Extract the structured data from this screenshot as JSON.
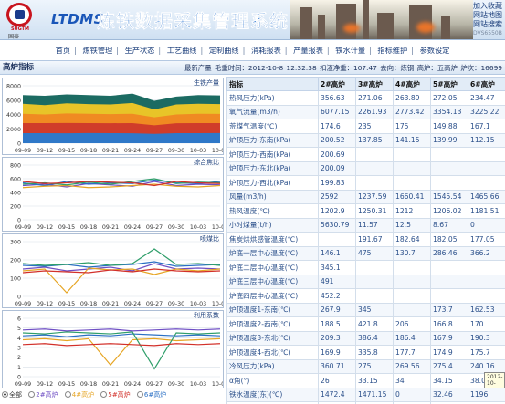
{
  "banner": {
    "logo_caption": "SUGTM",
    "logo_text": "国泰",
    "brand": "LTDMS",
    "title": "炼铁数据采集管理系统",
    "links": [
      "加入收藏",
      "网站地图",
      "网站搜索"
    ],
    "version": "DVS6550B"
  },
  "nav": [
    "首页",
    "炼铁管理",
    "生产状态",
    "工艺曲线",
    "定制曲线",
    "消耗报表",
    "产量报表",
    "铁水计量",
    "指标维护",
    "参数设定"
  ],
  "status": {
    "section_title": "高炉指标",
    "update_label": "最新产量 毛重时间：2012-10-8 12:32:38",
    "tapping_label": "扣渣净重：107.47",
    "grade_label": "去向：炼钢",
    "furnace_label": "高炉：五高炉",
    "count_label": "炉次：16699"
  },
  "charts": [
    {
      "title": "生铁产量",
      "yticks": [
        "8000",
        "6000",
        "4000",
        "2000",
        "0"
      ]
    },
    {
      "title": "综合焦比",
      "yticks": [
        "800",
        "600",
        "400",
        "200",
        "0"
      ]
    },
    {
      "title": "喷煤比",
      "yticks": [
        "300",
        "200",
        "100",
        "0"
      ]
    },
    {
      "title": "利用系数",
      "yticks": [
        "6",
        "5",
        "4",
        "3",
        "2",
        "1",
        "0"
      ]
    }
  ],
  "chart_data": [
    {
      "type": "area",
      "title": "生铁产量",
      "x": [
        "09-09",
        "09-12",
        "09-15",
        "09-18",
        "09-21",
        "09-24",
        "09-27",
        "09-30",
        "10-03",
        "10-06"
      ],
      "ylim": [
        0,
        8000
      ],
      "series": [
        {
          "values": [
            1400,
            1400,
            1380,
            1420,
            1400,
            1380,
            1300,
            1400,
            1400,
            1420
          ]
        },
        {
          "values": [
            2800,
            2790,
            2810,
            2800,
            2780,
            2800,
            2500,
            2780,
            2790,
            2800
          ]
        },
        {
          "values": [
            4100,
            4000,
            4150,
            4100,
            4050,
            4100,
            3600,
            4000,
            4100,
            4080
          ]
        },
        {
          "values": [
            5500,
            5300,
            5550,
            5450,
            5400,
            5600,
            4700,
            5400,
            5500,
            5450
          ]
        },
        {
          "values": [
            6700,
            6600,
            6800,
            6700,
            6600,
            6900,
            5900,
            6500,
            6700,
            6650
          ]
        }
      ]
    },
    {
      "type": "line",
      "title": "综合焦比",
      "x": [
        "09-09",
        "09-12",
        "09-15",
        "09-18",
        "09-21",
        "09-24",
        "09-27",
        "09-30",
        "10-03",
        "10-06"
      ],
      "ylim": [
        0,
        800
      ],
      "series": [
        {
          "values": [
            500,
            520,
            480,
            530,
            510,
            490,
            560,
            500,
            520,
            510
          ]
        },
        {
          "values": [
            540,
            500,
            560,
            520,
            540,
            530,
            580,
            540,
            530,
            560
          ]
        },
        {
          "values": [
            470,
            490,
            500,
            470,
            480,
            500,
            520,
            490,
            480,
            500
          ]
        },
        {
          "values": [
            520,
            540,
            510,
            550,
            520,
            560,
            600,
            530,
            550,
            540
          ]
        },
        {
          "values": [
            560,
            530,
            540,
            560,
            550,
            540,
            500,
            560,
            540,
            530
          ]
        }
      ]
    },
    {
      "type": "line",
      "title": "喷煤比",
      "x": [
        "09-09",
        "09-12",
        "09-15",
        "09-18",
        "09-21",
        "09-24",
        "09-27",
        "09-30",
        "10-03",
        "10-06"
      ],
      "ylim": [
        0,
        300
      ],
      "series": [
        {
          "values": [
            150,
            160,
            140,
            150,
            160,
            140,
            180,
            150,
            155,
            150
          ]
        },
        {
          "values": [
            170,
            165,
            175,
            160,
            170,
            175,
            190,
            165,
            170,
            175
          ]
        },
        {
          "values": [
            140,
            150,
            20,
            155,
            145,
            150,
            120,
            150,
            140,
            150
          ]
        },
        {
          "values": [
            180,
            170,
            175,
            185,
            170,
            180,
            260,
            175,
            180,
            170
          ]
        },
        {
          "values": [
            130,
            140,
            135,
            130,
            145,
            135,
            150,
            140,
            135,
            140
          ]
        }
      ]
    },
    {
      "type": "line",
      "title": "利用系数",
      "x": [
        "09-09",
        "09-12",
        "09-15",
        "09-18",
        "09-21",
        "09-24",
        "09-27",
        "09-30",
        "10-03",
        "10-06"
      ],
      "ylim": [
        0,
        6
      ],
      "series": [
        {
          "values": [
            4.8,
            4.9,
            4.7,
            4.8,
            4.9,
            4.7,
            4.8,
            4.9,
            4.8,
            4.9
          ]
        },
        {
          "values": [
            4.2,
            4.3,
            4.1,
            4.3,
            4.2,
            4.4,
            4.3,
            4.2,
            4.3,
            4.2
          ]
        },
        {
          "values": [
            3.8,
            3.9,
            3.7,
            3.9,
            1.2,
            3.8,
            3.9,
            3.7,
            3.8,
            3.9
          ]
        },
        {
          "values": [
            4.5,
            4.4,
            4.6,
            4.5,
            4.4,
            4.6,
            0.8,
            4.5,
            4.4,
            4.5
          ]
        },
        {
          "values": [
            3.3,
            3.4,
            3.2,
            3.3,
            3.4,
            3.3,
            3.2,
            3.4,
            3.3,
            3.4
          ]
        }
      ]
    }
  ],
  "legend": [
    "全部",
    "2#高炉",
    "4#高炉",
    "5#高炉",
    "6#高炉"
  ],
  "table": {
    "headers": [
      "指标",
      "2#高炉",
      "3#高炉",
      "4#高炉",
      "5#高炉",
      "6#高炉"
    ],
    "rows": [
      [
        "热风压力(kPa)",
        "356.63",
        "271.06",
        "263.89",
        "272.05",
        "234.47"
      ],
      [
        "氧气流量(m3/h)",
        "6077.15",
        "2261.93",
        "2773.42",
        "3354.13",
        "3225.22"
      ],
      [
        "荒煤气温度(℃)",
        "174.6",
        "235",
        "175",
        "149.88",
        "167.1"
      ],
      [
        "炉顶压力-东南(kPa)",
        "200.52",
        "137.85",
        "141.15",
        "139.99",
        "112.15"
      ],
      [
        "炉顶压力-西南(kPa)",
        "200.69",
        "",
        "",
        "",
        ""
      ],
      [
        "炉顶压力-东北(kPa)",
        "200.09",
        "",
        "",
        "",
        ""
      ],
      [
        "炉顶压力-西北(kPa)",
        "199.83",
        "",
        "",
        "",
        ""
      ],
      [
        "风量(m3/h)",
        "2592",
        "1237.59",
        "1660.41",
        "1545.54",
        "1465.66"
      ],
      [
        "热风温度(℃)",
        "1202.9",
        "1250.31",
        "1212",
        "1206.02",
        "1181.51"
      ],
      [
        "小时煤量(t/h)",
        "5630.79",
        "11.57",
        "12.5",
        "8.67",
        "0"
      ],
      [
        "焦炭烘烘感管温度(℃)",
        "",
        "191.67",
        "182.64",
        "182.05",
        "177.05"
      ],
      [
        "炉底一层中心温度(℃)",
        "146.1",
        "475",
        "130.7",
        "286.46",
        "366.2"
      ],
      [
        "炉底二层中心温度(℃)",
        "345.1",
        "",
        "",
        "",
        ""
      ],
      [
        "炉底三层中心温度(℃)",
        "491",
        "",
        "",
        "",
        ""
      ],
      [
        "炉底四层中心温度(℃)",
        "452.2",
        "",
        "",
        "",
        ""
      ],
      [
        "炉顶温度1-东南(℃)",
        "267.9",
        "345",
        "",
        "173.7",
        "162.53"
      ],
      [
        "炉顶温度2-西南(℃)",
        "188.5",
        "421.8",
        "206",
        "166.8",
        "170"
      ],
      [
        "炉顶温度3-东北(℃)",
        "209.3",
        "386.4",
        "186.4",
        "167.9",
        "190.3"
      ],
      [
        "炉顶温度4-西北(℃)",
        "169.9",
        "335.8",
        "177.7",
        "174.9",
        "175.7"
      ],
      [
        "冷风压力(kPa)",
        "360.71",
        "275",
        "269.56",
        "275.4",
        "240.16"
      ],
      [
        "α角(°)",
        "26",
        "33.15",
        "34",
        "34.15",
        "38.09"
      ],
      [
        "铁水温度(东)(℃)",
        "1472.4",
        "1471.15",
        "0",
        "32.46",
        "1196"
      ],
      [
        "铁水温度(西)(℃)",
        "1465.45",
        "",
        "",
        "",
        ""
      ]
    ]
  },
  "tooltip": "2012-10-"
}
